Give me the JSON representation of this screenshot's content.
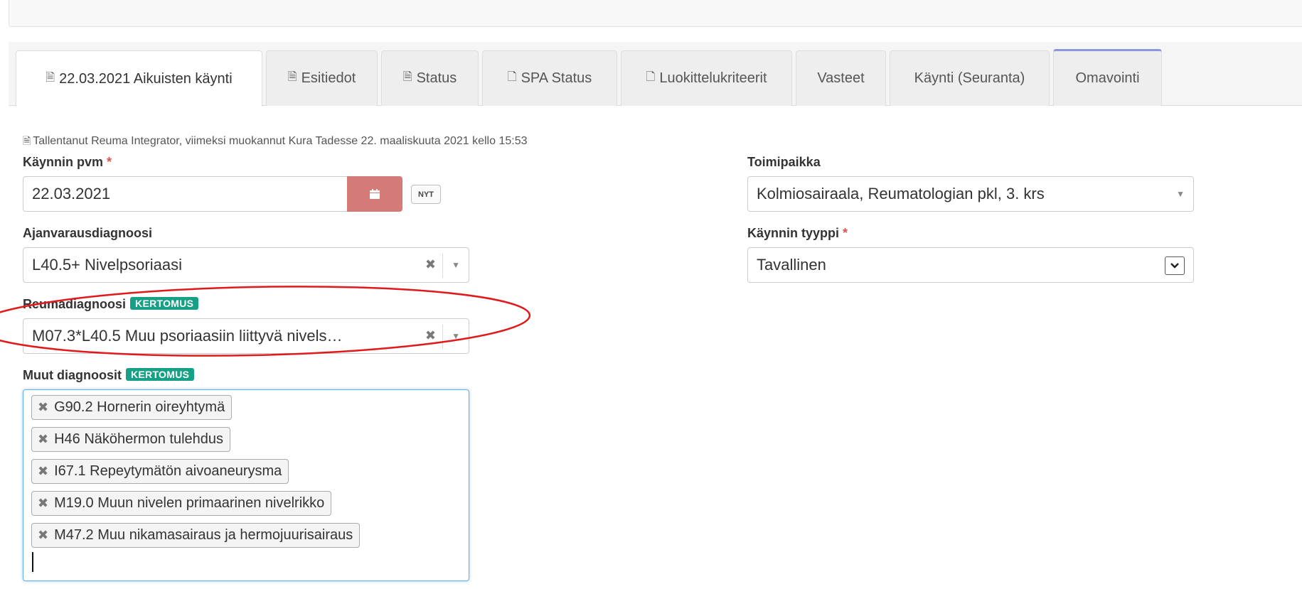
{
  "tabs": [
    {
      "label": "22.03.2021 Aikuisten käynti",
      "icon": "document-text-icon"
    },
    {
      "label": "Esitiedot",
      "icon": "document-text-icon"
    },
    {
      "label": "Status",
      "icon": "document-text-icon"
    },
    {
      "label": "SPA Status",
      "icon": "document-icon"
    },
    {
      "label": "Luokittelukriteerit",
      "icon": "document-icon"
    },
    {
      "label": "Vasteet"
    },
    {
      "label": "Käynti (Seuranta)"
    },
    {
      "label": "Omavointi"
    }
  ],
  "meta": {
    "saved_info": "Tallentanut Reuma Integrator, viimeksi muokannut Kura Tadesse 22. maaliskuuta 2021 kello 15:53"
  },
  "form": {
    "visit_date": {
      "label": "Käynnin pvm",
      "required_mark": "*",
      "value": "22.03.2021",
      "now_button": "NYT"
    },
    "location": {
      "label": "Toimipaikka",
      "value": "Kolmiosairaala, Reumatologian pkl, 3. krs"
    },
    "appointment_diagnosis": {
      "label": "Ajanvarausdiagnoosi",
      "value": "L40.5+ Nivelpsoriaasi"
    },
    "visit_type": {
      "label": "Käynnin tyyppi",
      "required_mark": "*",
      "value": "Tavallinen"
    },
    "rheuma_diagnosis": {
      "label": "Reumadiagnoosi",
      "badge": "KERTOMUS",
      "value": "M07.3*L40.5 Muu psoriaasiin liittyvä nivels…"
    },
    "other_diagnoses": {
      "label": "Muut diagnoosit",
      "badge": "KERTOMUS",
      "items": [
        "G90.2 Hornerin oireyhtymä",
        "H46 Näköhermon tulehdus",
        "I67.1 Repeytymätön aivoaneurysma",
        "M19.0 Muun nivelen primaarinen nivelrikko",
        "M47.2 Muu nikamasairaus ja hermojuurisairaus"
      ]
    }
  },
  "colors": {
    "badge": "#16a085",
    "calendar_button": "#d47a77",
    "annotation_ellipse": "#e0191b",
    "focus_border": "#66afe9",
    "active_tab_accent": "#8b97d8"
  }
}
